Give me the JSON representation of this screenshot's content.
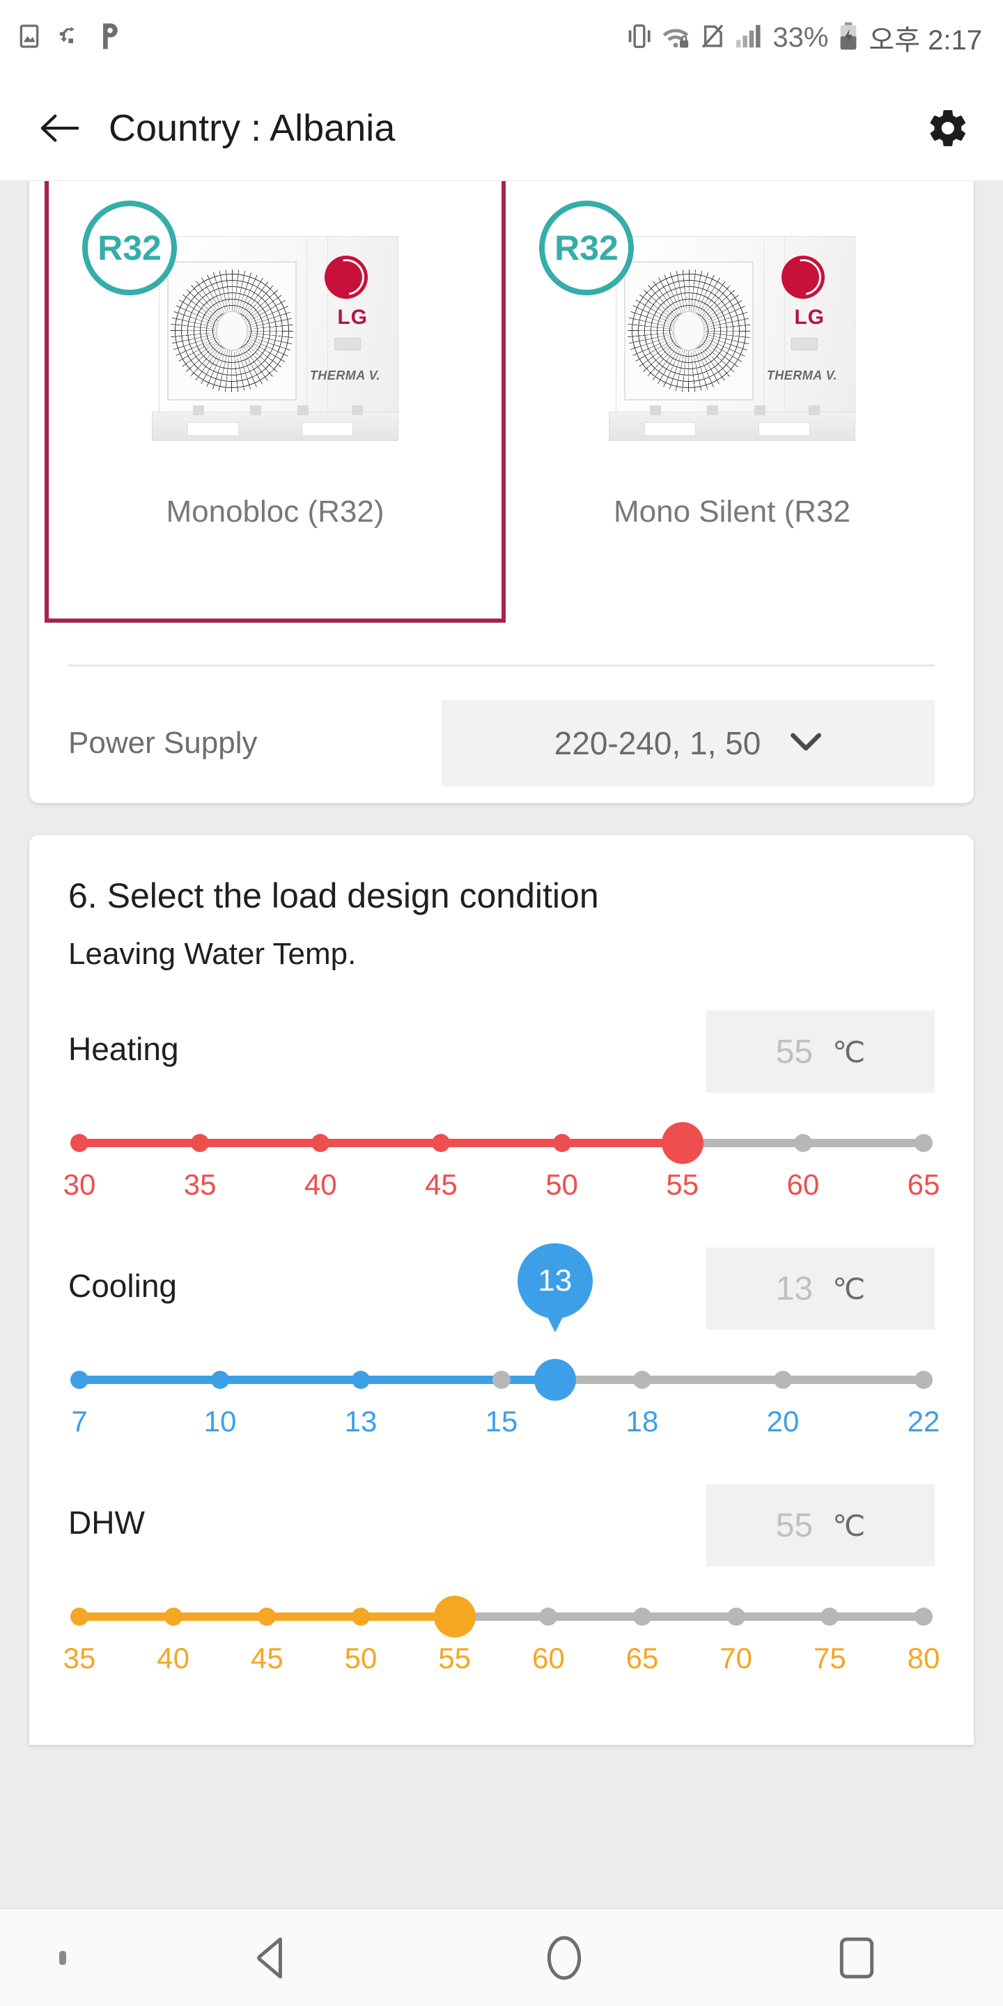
{
  "statusbar": {
    "icons_left": [
      "screenshot-icon",
      "usb-icon",
      "p-app-icon"
    ],
    "icons_right": [
      "vibrate-icon",
      "wifi-lock-icon",
      "nfc-off-icon",
      "signal-icon"
    ],
    "battery_percent": "33%",
    "time": "오후 2:17"
  },
  "appbar": {
    "back_icon": "back-arrow-icon",
    "title": "Country : Albania",
    "settings_icon": "gear-icon"
  },
  "products": {
    "items": [
      {
        "label": "Monobloc (R32)",
        "badge": "R32",
        "brand": "LG",
        "sub_brand": "THERMA V.",
        "selected": true
      },
      {
        "label": "Mono Silent (R32",
        "badge": "R32",
        "brand": "LG",
        "sub_brand": "THERMA V.",
        "selected": false
      }
    ]
  },
  "power_supply": {
    "label": "Power Supply",
    "value": "220-240, 1, 50",
    "chevron_icon": "chevron-down-icon"
  },
  "section": {
    "title": "6. Select the load design condition",
    "subtitle": "Leaving Water Temp."
  },
  "colors": {
    "heating": "#ef4e4e",
    "cooling": "#3d9fe8",
    "dhw": "#f5a623",
    "inactive": "#b7b7b7",
    "selected_border": "#a8234a",
    "badge": "#35ada8"
  },
  "sliders": [
    {
      "name": "Heating",
      "value": "55",
      "unit": "℃",
      "color": "#ef4e4e",
      "ticks": [
        "30",
        "35",
        "40",
        "45",
        "50",
        "55",
        "60",
        "65"
      ],
      "active_index": 5,
      "thumb_index": 5,
      "show_bubble": false
    },
    {
      "name": "Cooling",
      "value": "13",
      "unit": "℃",
      "color": "#3d9fe8",
      "ticks": [
        "7",
        "10",
        "13",
        "15",
        "18",
        "20",
        "22"
      ],
      "active_index": 2,
      "thumb_index": 3.38,
      "show_bubble": true,
      "bubble_text": "13"
    },
    {
      "name": "DHW",
      "value": "55",
      "unit": "℃",
      "color": "#f5a623",
      "ticks": [
        "35",
        "40",
        "45",
        "50",
        "55",
        "60",
        "65",
        "70",
        "75",
        "80"
      ],
      "active_index": 4,
      "thumb_index": 4,
      "show_bubble": false
    }
  ],
  "navbar": {
    "buttons": [
      "hide-nav-icon",
      "back-nav-icon",
      "home-nav-icon",
      "recents-nav-icon"
    ]
  }
}
